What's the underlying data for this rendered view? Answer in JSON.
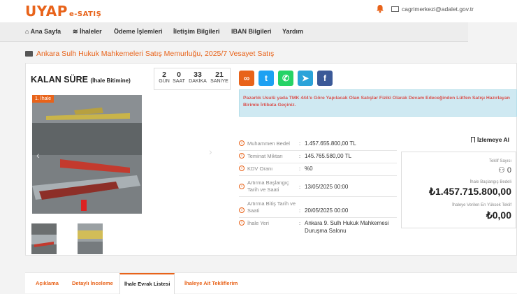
{
  "header": {
    "logo_main": "UYAP",
    "logo_sub": "e-SATIŞ",
    "email": "cagrimerkezi@adalet.gov.tr"
  },
  "nav": {
    "items": [
      "Ana Sayfa",
      "İhaleler",
      "Ödeme İşlemleri",
      "İletişim Bilgileri",
      "IBAN Bilgileri",
      "Yardım"
    ]
  },
  "page": {
    "title": "Ankara Sulh Hukuk Mahkemeleri Satış Memurluğu, 2025/7 Vesayet Satış"
  },
  "countdown": {
    "title": "KALAN SÜRE",
    "subtitle": "(İhale Bitimine)",
    "days": "2",
    "days_label": "GÜN",
    "hours": "0",
    "hours_label": "SAAT",
    "minutes": "33",
    "minutes_label": "DAKİKA",
    "seconds": "21",
    "seconds_label": "SANİYE"
  },
  "gallery": {
    "badge": "1. İhale"
  },
  "notice": "Pazarlık Usulü yada TMK 444'e Göre Yapılacak Olan Satışlar Fiziki Olarak Devam Edeceğinden Lütfen Satışı Hazırlayan Birimle İrtibata Geçiniz.",
  "info": [
    {
      "label": "Muhammen Bedel",
      "value": "1.457.655.800,00 TL"
    },
    {
      "label": "Teminat Miktarı",
      "value": "145.765.580,00 TL"
    },
    {
      "label": "KDV Oranı",
      "value": "%0"
    },
    {
      "label1": "Artırma Başlangıç",
      "label2": "Tarih ve Saati",
      "value": "13/05/2025 00:00"
    },
    {
      "label1": "Artırma Bitiş Tarih ve",
      "label2": "Saati",
      "value": "20/05/2025 00:00"
    },
    {
      "label": "İhale Yeri",
      "value1": "Ankara 9. Sulh Hukuk Mahkemesi",
      "value2": "Duruşma Salonu"
    }
  ],
  "watch_label": "İzlemeye Al",
  "bid": {
    "count_label": "Teklif Sayısı",
    "count": "0",
    "start_label": "İhale Başlangıç Bedeli",
    "start_value": "₺1.457.715.800,00",
    "highest_label": "İhaleye Verilen En Yüksek Teklif",
    "highest_value": "₺0,00"
  },
  "tabs": [
    "Açıklama",
    "Detaylı İnceleme",
    "İhale Evrak Listesi",
    "İhaleye Ait Tekliflerim"
  ],
  "colors": {
    "accent": "#e8631a",
    "notice_bg": "#cfe9f2",
    "notice_text": "#d9534f"
  },
  "icons": [
    "bell-icon",
    "mail-icon",
    "home-icon",
    "layers-icon",
    "folder-icon",
    "link-icon",
    "twitter-icon",
    "whatsapp-icon",
    "telegram-icon",
    "facebook-icon",
    "info-icon",
    "bookmark-icon",
    "user-group-icon"
  ]
}
